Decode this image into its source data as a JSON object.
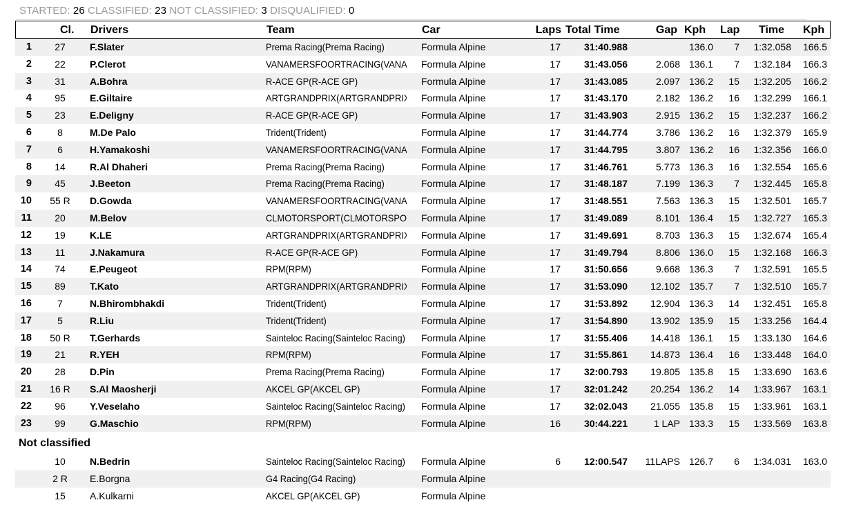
{
  "summary": {
    "started_label": "STARTED:",
    "started": "26",
    "classified_label": "CLASSIFIED:",
    "classified": "23",
    "not_classified_label": "NOT CLASSIFIED:",
    "not_classified": "3",
    "disqualified_label": "DISQUALIFIED:",
    "disqualified": "0"
  },
  "headers": {
    "cl": "Cl.",
    "drivers": "Drivers",
    "team": "Team",
    "car": "Car",
    "laps": "Laps",
    "total_time": "Total Time",
    "gap": "Gap",
    "kph": "Kph",
    "lap": "Lap",
    "time": "Time",
    "best_kph": "Kph"
  },
  "classified": [
    {
      "pos": "1",
      "no": "27",
      "driver": "F.Slater",
      "team": "Prema Racing(Prema Racing)",
      "car": "Formula Alpine",
      "laps": "17",
      "time": "31:40.988",
      "gap": "",
      "kph": "136.0",
      "lap": "7",
      "best": "1:32.058",
      "bkph": "166.5"
    },
    {
      "pos": "2",
      "no": "22",
      "driver": "P.Clerot",
      "team": "VANAMERSFOORTRACING(VANAME",
      "car": "Formula Alpine",
      "laps": "17",
      "time": "31:43.056",
      "gap": "2.068",
      "kph": "136.1",
      "lap": "7",
      "best": "1:32.184",
      "bkph": "166.3"
    },
    {
      "pos": "3",
      "no": "31",
      "driver": "A.Bohra",
      "team": "R-ACE GP(R-ACE GP)",
      "car": "Formula Alpine",
      "laps": "17",
      "time": "31:43.085",
      "gap": "2.097",
      "kph": "136.2",
      "lap": "15",
      "best": "1:32.205",
      "bkph": "166.2"
    },
    {
      "pos": "4",
      "no": "95",
      "driver": "E.Giltaire",
      "team": "ARTGRANDPRIX(ARTGRANDPRIX)",
      "car": "Formula Alpine",
      "laps": "17",
      "time": "31:43.170",
      "gap": "2.182",
      "kph": "136.2",
      "lap": "16",
      "best": "1:32.299",
      "bkph": "166.1"
    },
    {
      "pos": "5",
      "no": "23",
      "driver": "E.Deligny",
      "team": "R-ACE GP(R-ACE GP)",
      "car": "Formula Alpine",
      "laps": "17",
      "time": "31:43.903",
      "gap": "2.915",
      "kph": "136.2",
      "lap": "15",
      "best": "1:32.237",
      "bkph": "166.2"
    },
    {
      "pos": "6",
      "no": "8",
      "driver": "M.De Palo",
      "team": "Trident(Trident)",
      "car": "Formula Alpine",
      "laps": "17",
      "time": "31:44.774",
      "gap": "3.786",
      "kph": "136.2",
      "lap": "16",
      "best": "1:32.379",
      "bkph": "165.9"
    },
    {
      "pos": "7",
      "no": "6",
      "driver": "H.Yamakoshi",
      "team": "VANAMERSFOORTRACING(VANAME",
      "car": "Formula Alpine",
      "laps": "17",
      "time": "31:44.795",
      "gap": "3.807",
      "kph": "136.2",
      "lap": "16",
      "best": "1:32.356",
      "bkph": "166.0"
    },
    {
      "pos": "8",
      "no": "14",
      "driver": "R.Al Dhaheri",
      "team": "Prema Racing(Prema Racing)",
      "car": "Formula Alpine",
      "laps": "17",
      "time": "31:46.761",
      "gap": "5.773",
      "kph": "136.3",
      "lap": "16",
      "best": "1:32.554",
      "bkph": "165.6"
    },
    {
      "pos": "9",
      "no": "45",
      "driver": "J.Beeton",
      "team": "Prema Racing(Prema Racing)",
      "car": "Formula Alpine",
      "laps": "17",
      "time": "31:48.187",
      "gap": "7.199",
      "kph": "136.3",
      "lap": "7",
      "best": "1:32.445",
      "bkph": "165.8"
    },
    {
      "pos": "10",
      "no": "55 R",
      "driver": "D.Gowda",
      "team": "VANAMERSFOORTRACING(VANAME",
      "car": "Formula Alpine",
      "laps": "17",
      "time": "31:48.551",
      "gap": "7.563",
      "kph": "136.3",
      "lap": "15",
      "best": "1:32.501",
      "bkph": "165.7"
    },
    {
      "pos": "11",
      "no": "20",
      "driver": "M.Belov",
      "team": "CLMOTORSPORT(CLMOTORSPORT)",
      "car": "Formula Alpine",
      "laps": "17",
      "time": "31:49.089",
      "gap": "8.101",
      "kph": "136.4",
      "lap": "15",
      "best": "1:32.727",
      "bkph": "165.3"
    },
    {
      "pos": "12",
      "no": "19",
      "driver": "K.LE",
      "team": "ARTGRANDPRIX(ARTGRANDPRIX)",
      "car": "Formula Alpine",
      "laps": "17",
      "time": "31:49.691",
      "gap": "8.703",
      "kph": "136.3",
      "lap": "15",
      "best": "1:32.674",
      "bkph": "165.4"
    },
    {
      "pos": "13",
      "no": "11",
      "driver": "J.Nakamura",
      "team": "R-ACE GP(R-ACE GP)",
      "car": "Formula Alpine",
      "laps": "17",
      "time": "31:49.794",
      "gap": "8.806",
      "kph": "136.0",
      "lap": "15",
      "best": "1:32.168",
      "bkph": "166.3"
    },
    {
      "pos": "14",
      "no": "74",
      "driver": "E.Peugeot",
      "team": "RPM(RPM)",
      "car": "Formula Alpine",
      "laps": "17",
      "time": "31:50.656",
      "gap": "9.668",
      "kph": "136.3",
      "lap": "7",
      "best": "1:32.591",
      "bkph": "165.5"
    },
    {
      "pos": "15",
      "no": "89",
      "driver": "T.Kato",
      "team": "ARTGRANDPRIX(ARTGRANDPRIX)",
      "car": "Formula Alpine",
      "laps": "17",
      "time": "31:53.090",
      "gap": "12.102",
      "kph": "135.7",
      "lap": "7",
      "best": "1:32.510",
      "bkph": "165.7"
    },
    {
      "pos": "16",
      "no": "7",
      "driver": "N.Bhirombhakdi",
      "team": "Trident(Trident)",
      "car": "Formula Alpine",
      "laps": "17",
      "time": "31:53.892",
      "gap": "12.904",
      "kph": "136.3",
      "lap": "14",
      "best": "1:32.451",
      "bkph": "165.8"
    },
    {
      "pos": "17",
      "no": "5",
      "driver": "R.Liu",
      "team": "Trident(Trident)",
      "car": "Formula Alpine",
      "laps": "17",
      "time": "31:54.890",
      "gap": "13.902",
      "kph": "135.9",
      "lap": "15",
      "best": "1:33.256",
      "bkph": "164.4"
    },
    {
      "pos": "18",
      "no": "50 R",
      "driver": "T.Gerhards",
      "team": "Sainteloc Racing(Sainteloc Racing)",
      "car": "Formula Alpine",
      "laps": "17",
      "time": "31:55.406",
      "gap": "14.418",
      "kph": "136.1",
      "lap": "15",
      "best": "1:33.130",
      "bkph": "164.6"
    },
    {
      "pos": "19",
      "no": "21",
      "driver": "R.YEH",
      "team": "RPM(RPM)",
      "car": "Formula Alpine",
      "laps": "17",
      "time": "31:55.861",
      "gap": "14.873",
      "kph": "136.4",
      "lap": "16",
      "best": "1:33.448",
      "bkph": "164.0"
    },
    {
      "pos": "20",
      "no": "28",
      "driver": "D.Pin",
      "team": "Prema Racing(Prema Racing)",
      "car": "Formula Alpine",
      "laps": "17",
      "time": "32:00.793",
      "gap": "19.805",
      "kph": "135.8",
      "lap": "15",
      "best": "1:33.690",
      "bkph": "163.6"
    },
    {
      "pos": "21",
      "no": "16 R",
      "driver": "S.Al Maosherji",
      "team": "AKCEL GP(AKCEL GP)",
      "car": "Formula Alpine",
      "laps": "17",
      "time": "32:01.242",
      "gap": "20.254",
      "kph": "136.2",
      "lap": "14",
      "best": "1:33.967",
      "bkph": "163.1"
    },
    {
      "pos": "22",
      "no": "96",
      "driver": "Y.Veselaho",
      "team": "Sainteloc Racing(Sainteloc Racing)",
      "car": "Formula Alpine",
      "laps": "17",
      "time": "32:02.043",
      "gap": "21.055",
      "kph": "135.8",
      "lap": "15",
      "best": "1:33.961",
      "bkph": "163.1"
    },
    {
      "pos": "23",
      "no": "99",
      "driver": "G.Maschio",
      "team": "RPM(RPM)",
      "car": "Formula Alpine",
      "laps": "16",
      "time": "30:44.221",
      "gap": "1 LAP",
      "kph": "133.3",
      "lap": "15",
      "best": "1:33.569",
      "bkph": "163.8"
    }
  ],
  "not_classified_title": "Not classified",
  "not_classified": [
    {
      "pos": "",
      "no": "10",
      "driver": "N.Bedrin",
      "team": "Sainteloc Racing(Sainteloc Racing)",
      "car": "Formula Alpine",
      "laps": "6",
      "time": "12:00.547",
      "gap": "11LAPS",
      "kph": "126.7",
      "lap": "6",
      "best": "1:34.031",
      "bkph": "163.0",
      "bold": true
    },
    {
      "pos": "",
      "no": "2 R",
      "driver": "E.Borgna",
      "team": "G4 Racing(G4 Racing)",
      "car": "Formula Alpine",
      "laps": "",
      "time": "",
      "gap": "",
      "kph": "",
      "lap": "",
      "best": "",
      "bkph": "",
      "bold": false
    },
    {
      "pos": "",
      "no": "15",
      "driver": "A.Kulkarni",
      "team": "AKCEL GP(AKCEL GP)",
      "car": "Formula Alpine",
      "laps": "",
      "time": "",
      "gap": "",
      "kph": "",
      "lap": "",
      "best": "",
      "bkph": "",
      "bold": false
    }
  ]
}
